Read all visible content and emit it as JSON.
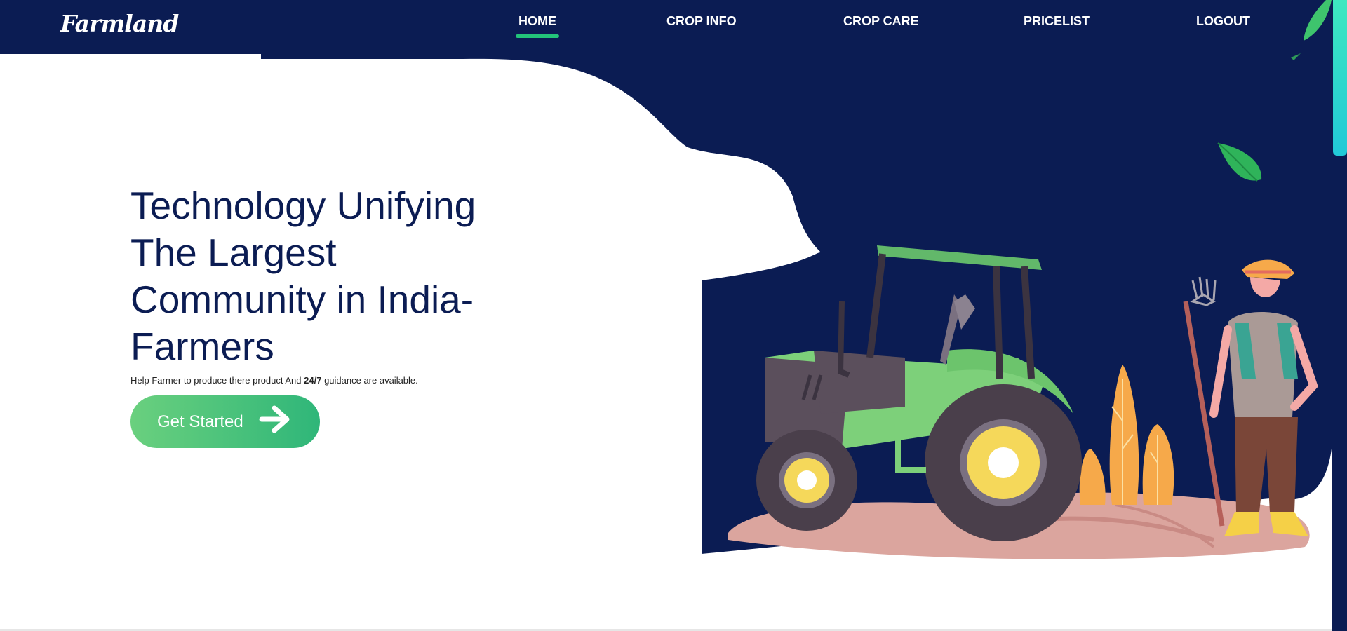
{
  "brand": {
    "logo_text": "Farmland"
  },
  "nav": {
    "items": [
      {
        "label": "HOME",
        "active": true
      },
      {
        "label": "CROP INFO",
        "active": false
      },
      {
        "label": "CROP CARE",
        "active": false
      },
      {
        "label": "PRICELIST",
        "active": false
      },
      {
        "label": "LOGOUT",
        "active": false
      }
    ]
  },
  "hero": {
    "title_lines": [
      "Technology Unifying",
      "The Largest",
      "Community in India-",
      "Farmers"
    ],
    "subtitle_start": "Help Farmer to produce there product And ",
    "subtitle_bold": "24/7",
    "subtitle_end": " guidance are available.",
    "cta_label": "Get Started"
  },
  "icons": {
    "cta_arrow": "arrow-right-icon",
    "illustration": "tractor-farmer-illustration"
  },
  "colors": {
    "navy": "#0b1c53",
    "accent_green": "#23c47a",
    "button_gradient_start": "#6ad07e",
    "button_gradient_end": "#2fb679",
    "scroll_thumb": "#2ed9cc"
  }
}
